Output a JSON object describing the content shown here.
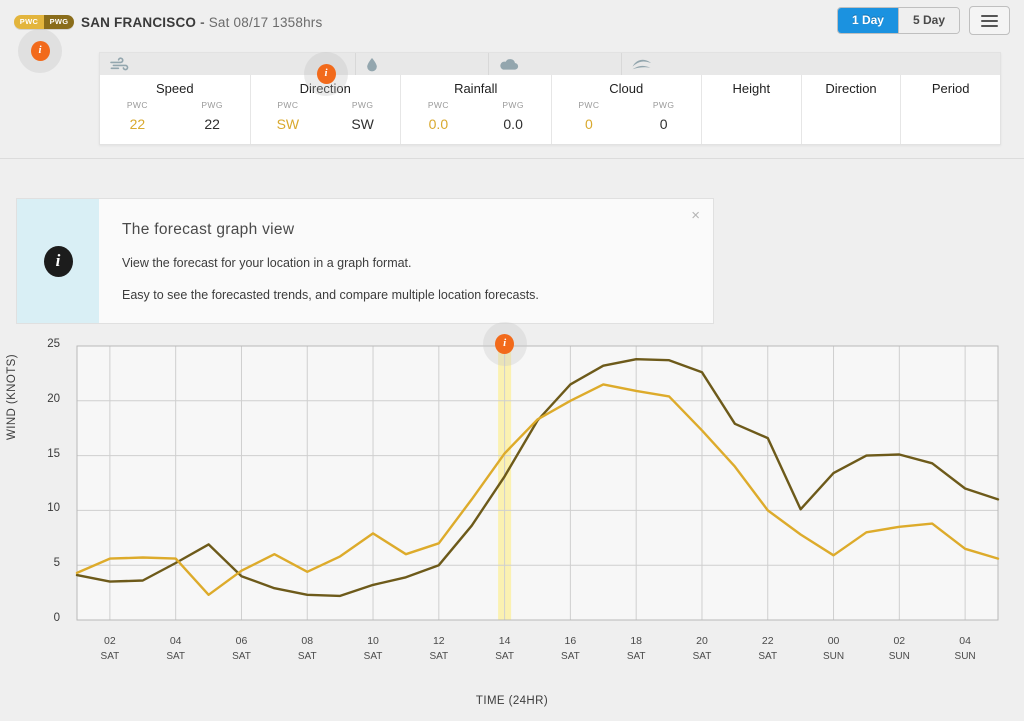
{
  "header": {
    "badges": [
      {
        "id": "pwc",
        "label": "PWC",
        "color": "#e3b53d"
      },
      {
        "id": "pwg",
        "label": "PWG",
        "color": "#8a6d1b"
      }
    ],
    "location": "SAN FRANCISCO",
    "separator": "-",
    "datetime": "Sat 08/17 1358hrs",
    "info_icon": "info-icon",
    "range_buttons": [
      {
        "label": "1 Day",
        "active": true
      },
      {
        "label": "5 Day",
        "active": false
      }
    ],
    "menu_icon": "hamburger-menu-icon"
  },
  "summary": {
    "sub_labels": {
      "pwc": "PWC",
      "pwg": "PWG"
    },
    "groups": [
      {
        "icon": "wind-icon",
        "columns": [
          {
            "name": "Speed",
            "pwc": "22",
            "pwg": "22"
          },
          {
            "name": "Direction",
            "pwc": "SW",
            "pwg": "SW",
            "info_icon": "info-icon"
          }
        ]
      },
      {
        "icon": "raindrop-icon",
        "columns": [
          {
            "name": "Rainfall",
            "pwc": "0.0",
            "pwg": "0.0"
          }
        ]
      },
      {
        "icon": "cloud-icon",
        "columns": [
          {
            "name": "Cloud",
            "pwc": "0",
            "pwg": "0"
          }
        ]
      },
      {
        "icon": "swell-waves-icon",
        "columns": [
          {
            "name": "Height",
            "pwc": "",
            "pwg": ""
          },
          {
            "name": "Direction",
            "pwc": "",
            "pwg": ""
          },
          {
            "name": "Period",
            "pwc": "",
            "pwg": ""
          }
        ]
      }
    ]
  },
  "banner": {
    "icon": "info-icon",
    "title": "The forecast graph view",
    "paragraphs": [
      "View the forecast for your location in a graph format.",
      "Easy to see the forecasted trends, and compare multiple location forecasts."
    ],
    "close_label": "×"
  },
  "chart_info_badge": {
    "icon": "info-icon"
  },
  "chart_data": {
    "type": "line",
    "title": "",
    "xlabel": "TIME (24HR)",
    "ylabel": "WIND (KNOTS)",
    "ylim": [
      0,
      25
    ],
    "yticks": [
      0,
      5,
      10,
      15,
      20,
      25
    ],
    "grid": true,
    "legend": "none",
    "highlight_x": "14",
    "highlight_color": "#fbf0a8",
    "xticks": [
      {
        "hour": "02",
        "day": "SAT"
      },
      {
        "hour": "04",
        "day": "SAT"
      },
      {
        "hour": "06",
        "day": "SAT"
      },
      {
        "hour": "08",
        "day": "SAT"
      },
      {
        "hour": "10",
        "day": "SAT"
      },
      {
        "hour": "12",
        "day": "SAT"
      },
      {
        "hour": "14",
        "day": "SAT"
      },
      {
        "hour": "16",
        "day": "SAT"
      },
      {
        "hour": "18",
        "day": "SAT"
      },
      {
        "hour": "20",
        "day": "SAT"
      },
      {
        "hour": "22",
        "day": "SAT"
      },
      {
        "hour": "00",
        "day": "SUN"
      },
      {
        "hour": "02",
        "day": "SUN"
      },
      {
        "hour": "04",
        "day": "SUN"
      }
    ],
    "x": [
      1,
      2,
      3,
      4,
      5,
      6,
      7,
      8,
      9,
      10,
      11,
      12,
      13,
      14,
      15,
      16,
      17,
      18,
      19,
      20,
      21,
      22,
      23,
      24,
      25,
      26,
      27,
      28,
      29
    ],
    "series": [
      {
        "name": "PWG",
        "color": "#6d5a1a",
        "values": [
          4.1,
          3.5,
          3.6,
          5.2,
          6.9,
          4.0,
          2.9,
          2.3,
          2.2,
          3.2,
          3.9,
          5.0,
          8.6,
          13.1,
          18.2,
          21.5,
          23.2,
          23.8,
          23.7,
          22.6,
          17.9,
          16.6,
          10.1,
          13.4,
          15.0,
          15.1,
          14.3,
          12.0,
          11.0
        ]
      },
      {
        "name": "PWC",
        "color": "#ddab2b",
        "values": [
          4.3,
          5.6,
          5.7,
          5.6,
          2.3,
          4.5,
          6.0,
          4.4,
          5.8,
          7.9,
          6.0,
          7.0,
          11.0,
          15.2,
          18.3,
          20.0,
          21.5,
          20.9,
          20.4,
          17.3,
          14.0,
          10.0,
          7.8,
          5.9,
          8.0,
          8.5,
          8.8,
          6.5,
          5.6
        ]
      }
    ]
  }
}
